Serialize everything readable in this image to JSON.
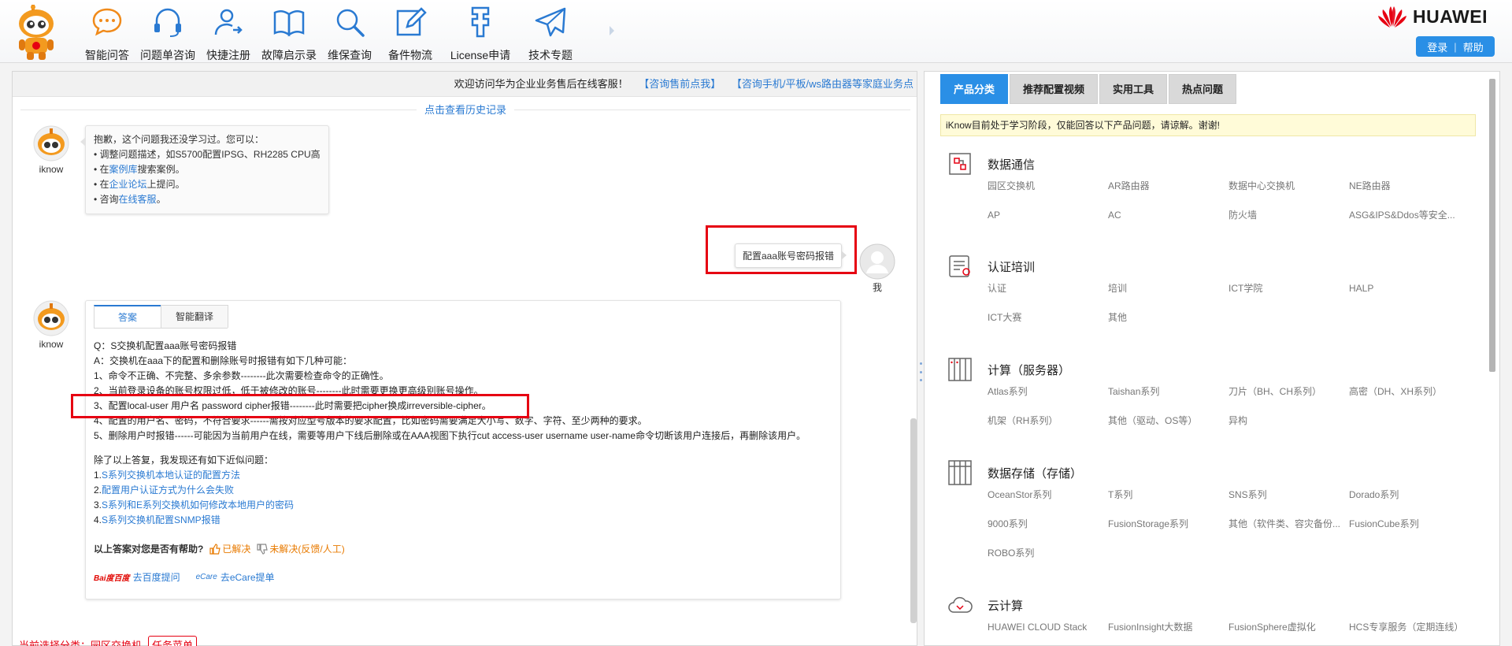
{
  "nav": {
    "items": [
      {
        "label": "智能问答",
        "icon": "chat-bubble-icon"
      },
      {
        "label": "问题单咨询",
        "icon": "headset-icon"
      },
      {
        "label": "快捷注册",
        "icon": "user-register-icon"
      },
      {
        "label": "故障启示录",
        "icon": "open-book-icon"
      },
      {
        "label": "维保查询",
        "icon": "magnifier-icon"
      },
      {
        "label": "备件物流",
        "icon": "edit-icon"
      },
      {
        "label": "License申请",
        "icon": "license-icon"
      },
      {
        "label": "技术专题",
        "icon": "paper-plane-icon"
      }
    ]
  },
  "brand": {
    "name": "HUAWEI",
    "color": "#e60012"
  },
  "auth": {
    "login": "登录",
    "sep": "|",
    "help": "帮助"
  },
  "chat": {
    "welcome": "欢迎访问华为企业业务售后在线客服！",
    "welcome_link1": "【咨询售前点我】",
    "welcome_link2": "【咨询手机/平板/ws路由器等家庭业务点",
    "history": "点击查看历史记录",
    "bot_name": "iknow",
    "user_name": "我",
    "bot_msg": {
      "line1": "抱歉，这个问题我还没学习过。您可以：",
      "line2": "• 调整问题描述，如S5700配置IPSG、RH2285 CPU高",
      "line3_pre": "• 在",
      "line3_link": "案例库",
      "line3_post": "搜索案例。",
      "line4_pre": "• 在",
      "line4_link": "企业论坛",
      "line4_post": "上提问。",
      "line5_pre": "• 咨询",
      "line5_link": "在线客服",
      "line5_post": "。"
    },
    "user_msg": "配置aaa账号密码报错",
    "answer": {
      "tab_answer": "答案",
      "tab_translate": "智能翻译",
      "q": "Q：S交换机配置aaa账号密码报错",
      "a": "A：交换机在aaa下的配置和删除账号时报错有如下几种可能：",
      "l1": "1、命令不正确、不完整、多余参数--------此次需要检查命令的正确性。",
      "l2": "2、当前登录设备的账号权限过低，低于被修改的账号--------此时需要更换更高级别账号操作。",
      "l3": "3、配置local-user 用户名 password cipher报错--------此时需要把cipher换成irreversible-cipher。",
      "l4": "4、配置的用户名、密码，不符合要求------需按对应型号版本的要求配置，比如密码需要满足大小写、数字、字符、至少两种的要求。",
      "l5": "5、删除用户时报错------可能因为当前用户在线，需要等用户下线后删除或在AAA视图下执行cut access-user username user-name命令切断该用户连接后，再删除该用户。",
      "related_title": "除了以上答复，我发现还有如下近似问题：",
      "related": [
        {
          "num": "1.",
          "text": "S系列交换机本地认证的配置方法"
        },
        {
          "num": "2.",
          "text": "配置用户认证方式为什么会失败"
        },
        {
          "num": "3.",
          "text": "S系列和E系列交换机如何修改本地用户的密码"
        },
        {
          "num": "4.",
          "text": "S系列交换机配置SNMP报错"
        }
      ],
      "feedback_q": "以上答案对您是否有帮助?",
      "solved": "已解决",
      "unsolved": "未解决(反馈/人工)",
      "baidu_logo": "Bai度百度",
      "baidu": "去百度提问",
      "ecare_logo": "eCare",
      "ecare": "去eCare提单"
    },
    "status_label": "当前选择分类：",
    "status_value": "园区交换机",
    "task_button": "任务菜单"
  },
  "right": {
    "tabs": [
      "产品分类",
      "推荐配置视频",
      "实用工具",
      "热点问题"
    ],
    "notice": "iKnow目前处于学习阶段，仅能回答以下产品问题，请谅解。谢谢!",
    "categories": [
      {
        "title": "数据通信",
        "icon": "network-device-icon",
        "items": [
          "园区交换机",
          "AR路由器",
          "数据中心交换机",
          "NE路由器",
          "AP",
          "AC",
          "防火墙",
          "ASG&IPS&Ddos等安全..."
        ]
      },
      {
        "title": "认证培训",
        "icon": "certificate-icon",
        "items": [
          "认证",
          "培训",
          "ICT学院",
          "HALP",
          "ICT大赛",
          "其他"
        ]
      },
      {
        "title": "计算（服务器）",
        "icon": "server-rack-icon",
        "items": [
          "Atlas系列",
          "Taishan系列",
          "刀片（BH、CH系列）",
          "高密（DH、XH系列）",
          "机架（RH系列）",
          "其他（驱动、OS等）",
          "异构"
        ]
      },
      {
        "title": "数据存储（存储）",
        "icon": "storage-cabinet-icon",
        "items": [
          "OceanStor系列",
          "T系列",
          "SNS系列",
          "Dorado系列",
          "9000系列",
          "FusionStorage系列",
          "其他（软件类、容灾备份...",
          "FusionCube系列",
          "ROBO系列"
        ]
      },
      {
        "title": "云计算",
        "icon": "cloud-icon",
        "items": [
          "HUAWEI CLOUD Stack",
          "FusionInsight大数据",
          "FusionSphere虚拟化",
          "HCS专享服务（定期连线）"
        ]
      }
    ]
  }
}
